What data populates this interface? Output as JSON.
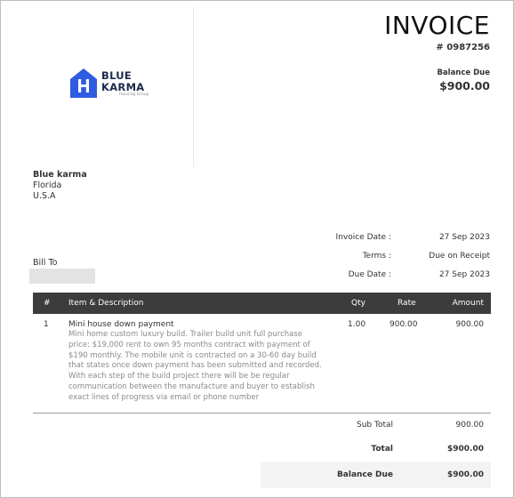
{
  "company": {
    "logo_line1": "BLUE",
    "logo_line2": "KARMA",
    "logo_sub": "Housing Group",
    "brand_color": "#2f5be0"
  },
  "header": {
    "title": "INVOICE",
    "number": "# 0987256",
    "balance_label": "Balance Due",
    "balance_amount": "$900.00"
  },
  "from": {
    "name": "Blue karma",
    "line1": "Florida",
    "line2": "U.S.A"
  },
  "bill_to": {
    "label": "Bill To"
  },
  "meta": [
    {
      "label": "Invoice Date :",
      "value": "27 Sep 2023"
    },
    {
      "label": "Terms :",
      "value": "Due on Receipt"
    },
    {
      "label": "Due Date :",
      "value": "27 Sep 2023"
    }
  ],
  "table": {
    "columns": [
      "#",
      "Item & Description",
      "Qty",
      "Rate",
      "Amount"
    ],
    "header_bg": "#3c3c3c",
    "rows": [
      {
        "num": "1",
        "title": "Mini house down payment",
        "description": "Mini home custom luxury build. Trailer build unit full purchase price: $19,000 rent to own 95 months contract with payment of $190 monthly. The mobile unit is contracted on a 30-60 day build that states once down payment has been submitted and recorded. With each step of the build project there will be be regular communication between the manufacture and buyer to establish exact lines of progress via email or phone number",
        "qty": "1.00",
        "rate": "900.00",
        "amount": "900.00"
      }
    ]
  },
  "totals": {
    "subtotal_label": "Sub Total",
    "subtotal": "900.00",
    "total_label": "Total",
    "total": "$900.00",
    "balance_due_label": "Balance Due",
    "balance_due": "$900.00"
  }
}
